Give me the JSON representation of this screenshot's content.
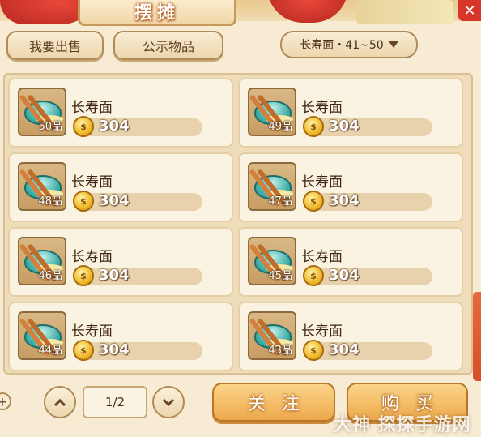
{
  "header": {
    "title": "摆摊",
    "close_label": "✕"
  },
  "tabs": {
    "sell_label": "我要出售",
    "public_label": "公示物品"
  },
  "filter": {
    "selected": "长寿面・41~50"
  },
  "items": [
    {
      "name": "长寿面",
      "grade": "50品",
      "price": "304",
      "icon": "noodle-bowl-icon"
    },
    {
      "name": "长寿面",
      "grade": "49品",
      "price": "304",
      "icon": "noodle-bowl-icon"
    },
    {
      "name": "长寿面",
      "grade": "48品",
      "price": "304",
      "icon": "noodle-bowl-icon"
    },
    {
      "name": "长寿面",
      "grade": "47品",
      "price": "304",
      "icon": "noodle-bowl-icon"
    },
    {
      "name": "长寿面",
      "grade": "46品",
      "price": "304",
      "icon": "noodle-bowl-icon"
    },
    {
      "name": "长寿面",
      "grade": "45品",
      "price": "304",
      "icon": "noodle-bowl-icon"
    },
    {
      "name": "长寿面",
      "grade": "44品",
      "price": "304",
      "icon": "noodle-bowl-icon"
    },
    {
      "name": "长寿面",
      "grade": "43品",
      "price": "304",
      "icon": "noodle-bowl-icon"
    }
  ],
  "pagination": {
    "page": "1/2"
  },
  "actions": {
    "follow_label": "关注",
    "buy_label": "购买"
  },
  "watermark": "大神 探探手游网",
  "colors": {
    "accent_red": "#d8362b",
    "button_gold": "#eda84b",
    "panel_bg": "#efdcb8"
  }
}
